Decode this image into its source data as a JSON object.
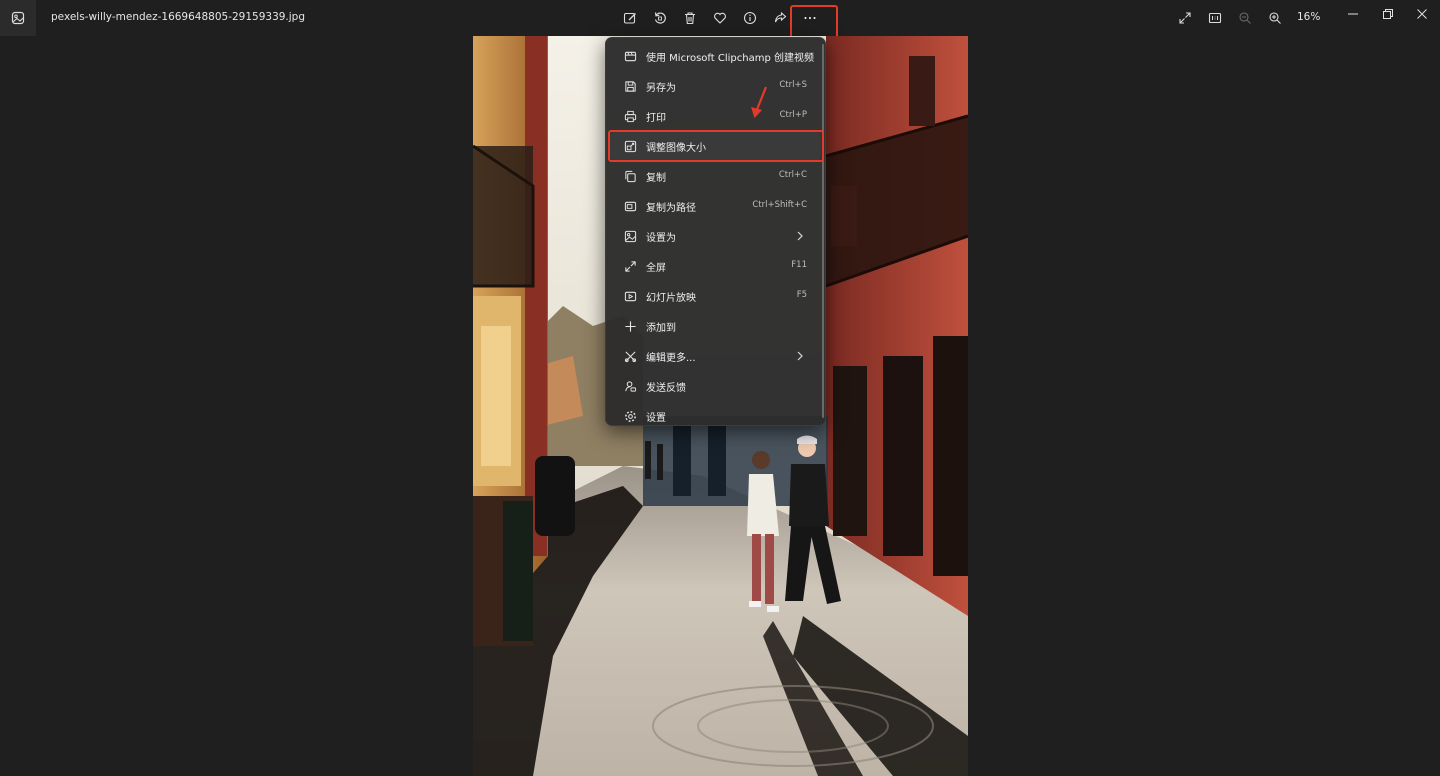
{
  "app": {
    "file_name": "pexels-willy-mendez-1669648805-29159339.jpg"
  },
  "toolbar": {
    "zoom_level": "16%"
  },
  "menu": {
    "items": [
      {
        "label": "使用 Microsoft Clipchamp 创建视频",
        "shortcut": "",
        "icon": "clipchamp-icon"
      },
      {
        "label": "另存为",
        "shortcut": "Ctrl+S",
        "icon": "save-icon"
      },
      {
        "label": "打印",
        "shortcut": "Ctrl+P",
        "icon": "print-icon"
      },
      {
        "label": "调整图像大小",
        "shortcut": "",
        "icon": "resize-icon"
      },
      {
        "label": "复制",
        "shortcut": "Ctrl+C",
        "icon": "copy-icon"
      },
      {
        "label": "复制为路径",
        "shortcut": "Ctrl+Shift+C",
        "icon": "copy-path-icon"
      },
      {
        "label": "设置为",
        "shortcut": "",
        "icon": "set-as-icon",
        "submenu": true
      },
      {
        "label": "全屏",
        "shortcut": "F11",
        "icon": "fullscreen-icon"
      },
      {
        "label": "幻灯片放映",
        "shortcut": "F5",
        "icon": "slideshow-icon"
      },
      {
        "label": "添加到",
        "shortcut": "",
        "icon": "plus-icon"
      },
      {
        "label": "编辑更多...",
        "shortcut": "",
        "icon": "edit-more-icon",
        "submenu": true
      },
      {
        "label": "发送反馈",
        "shortcut": "",
        "icon": "feedback-icon"
      },
      {
        "label": "设置",
        "shortcut": "",
        "icon": "settings-icon"
      }
    ]
  },
  "colors": {
    "highlight": "#e53a2a",
    "menu_bg": "#2c2c2c",
    "app_bg": "#1f1f1f"
  }
}
